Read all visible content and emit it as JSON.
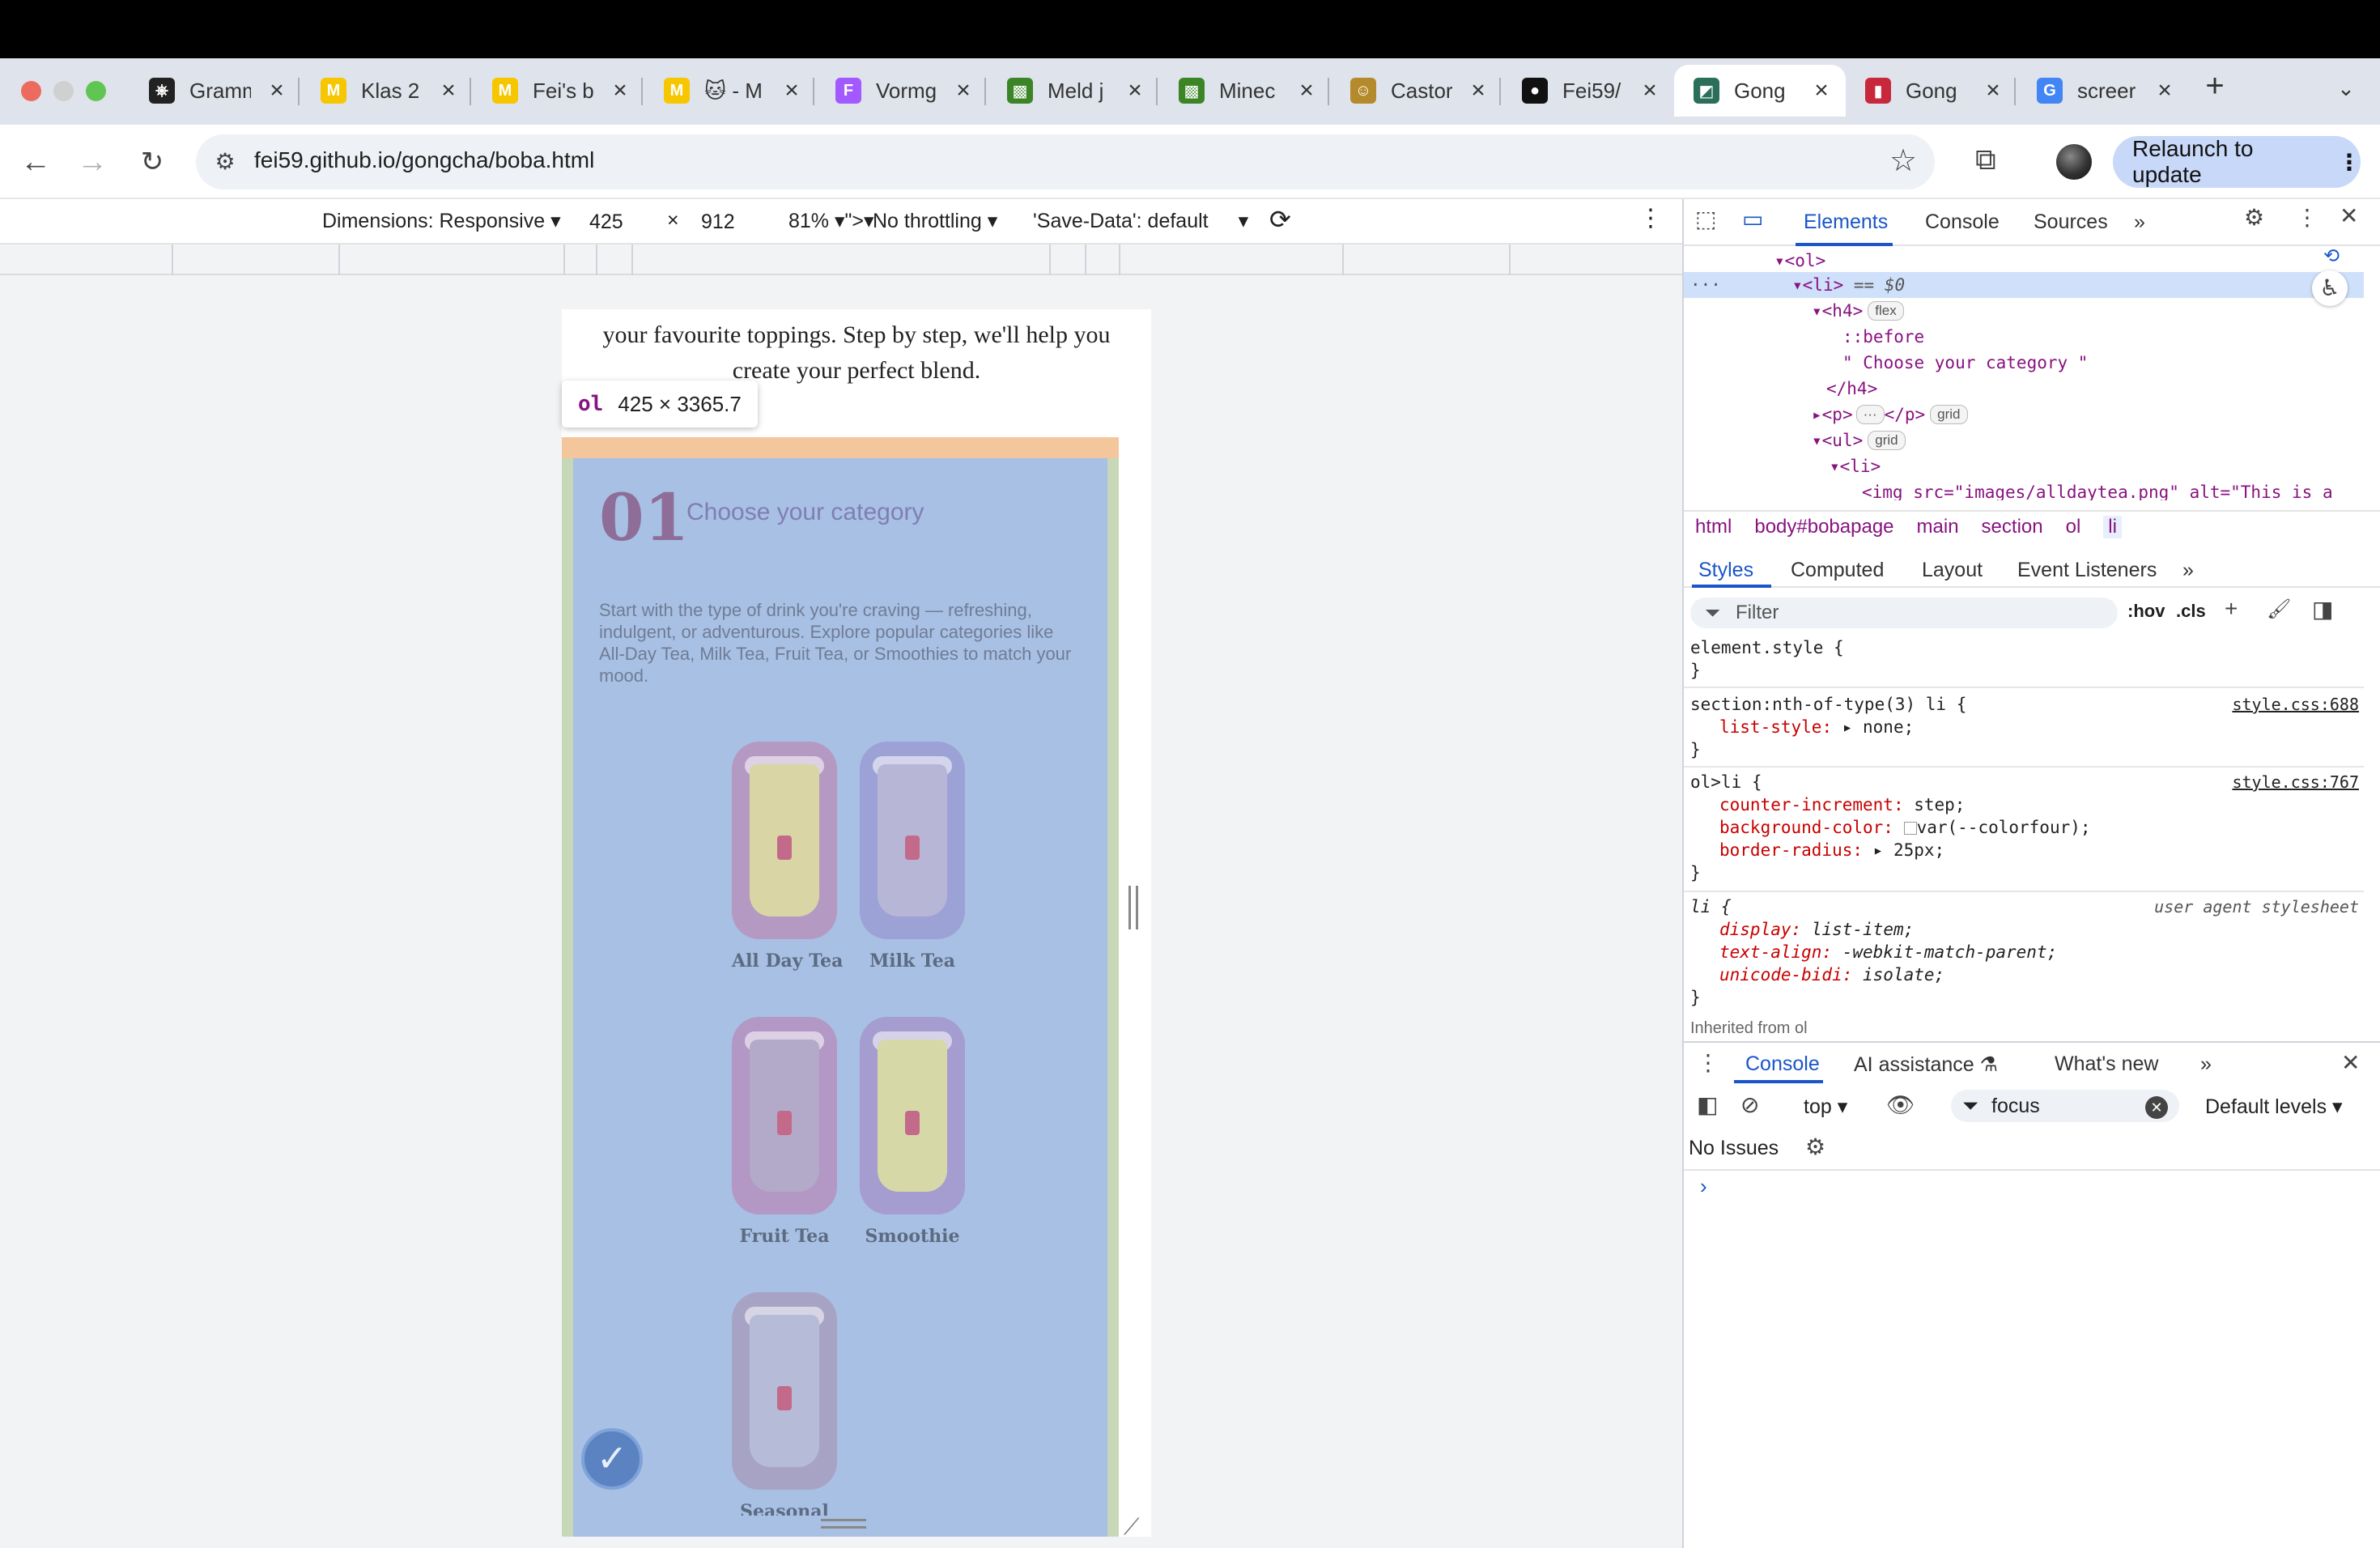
{
  "window": {
    "traffic_lights": [
      "#ed6a5e",
      "#d0d0d0",
      "#61c554"
    ]
  },
  "tabs": [
    {
      "title": "Gramm",
      "icon": "chatgpt-icon",
      "color": "#222222",
      "glyph": "⎈"
    },
    {
      "title": "Klas 2",
      "icon": "miro-icon",
      "color": "#f6c700",
      "glyph": "M"
    },
    {
      "title": "Fei's b",
      "icon": "miro-icon",
      "color": "#f6c700",
      "glyph": "M"
    },
    {
      "title": "🐱 - M",
      "icon": "miro-icon",
      "color": "#f6c700",
      "glyph": "M"
    },
    {
      "title": "Vormg",
      "icon": "figma-icon",
      "color": "#a259ff",
      "glyph": "F"
    },
    {
      "title": "Meld j",
      "icon": "minecraft-icon",
      "color": "#3c8527",
      "glyph": "▩"
    },
    {
      "title": "Minec",
      "icon": "minecraft-icon",
      "color": "#3c8527",
      "glyph": "▩"
    },
    {
      "title": "Castor",
      "icon": "castor-icon",
      "color": "#b58a2c",
      "glyph": "☺"
    },
    {
      "title": "Fei59/",
      "icon": "github-icon",
      "color": "#111111",
      "glyph": "●"
    },
    {
      "title": "Gong",
      "icon": "gongcha-icon",
      "color": "#2b6e5a",
      "glyph": "◩",
      "active": true
    },
    {
      "title": "Gong",
      "icon": "gongcha-red-icon",
      "color": "#c8283c",
      "glyph": "▮"
    },
    {
      "title": "screer",
      "icon": "google-icon",
      "color": "#4285f4",
      "glyph": "G"
    }
  ],
  "toolbar": {
    "url": "fei59.github.io/gongcha/boba.html",
    "relaunch_label": "Relaunch to update"
  },
  "device_toolbar": {
    "dimensions": "Dimensions: Responsive",
    "width": "425",
    "times": "×",
    "height": "912",
    "zoom": "81%",
    "throttling": "No throttling",
    "save_data": "'Save-Data': default"
  },
  "page": {
    "intro": "your favourite toppings. Step by step, we'll help you create your perfect blend.",
    "step_number": "01",
    "step_title": "Choose your category",
    "step_description": "Start with the type of drink you're craving — refreshing, indulgent, or adventurous. Explore popular categories like All-Day Tea, Milk Tea, Fruit Tea, or Smoothies to match your mood.",
    "categories": [
      {
        "label": "All Day Tea",
        "bg": "#b49ac2",
        "drink": "#d9d5a4"
      },
      {
        "label": "Milk Tea",
        "bg": "#9da2d6",
        "drink": "#b8b6d6"
      },
      {
        "label": "Fruit Tea",
        "bg": "#b397c4",
        "drink": "#b3a9c9"
      },
      {
        "label": "Smoothie",
        "bg": "#a59ccf",
        "drink": "#d7d8a8"
      },
      {
        "label": "Seasonal",
        "bg": "#a7a3c4",
        "drink": "#b6bcd8"
      }
    ],
    "tooltip_tag": "ol",
    "tooltip_size": "425 × 3365.7"
  },
  "devtools": {
    "tabs": [
      "Elements",
      "Console",
      "Sources"
    ],
    "tree": {
      "ol_open": "<ol>",
      "li_open": "<li>",
      "li_marker": "== $0",
      "h4_open": "<h4>",
      "before": "::before",
      "h4_text": "\" Choose your category \"",
      "h4_close": "</h4>",
      "p_line": "<p>",
      "p_close": "</p>",
      "ul_open": "<ul>",
      "li2_open": "<li>",
      "img_line": "<img src=\"images/alldaytea.png\" alt=\"This is a",
      "badge_flex": "flex",
      "badge_grid": "grid"
    },
    "breadcrumbs": [
      "html",
      "body#bobapage",
      "main",
      "section",
      "ol",
      "li"
    ],
    "styles_tabs": [
      "Styles",
      "Computed",
      "Layout",
      "Event Listeners"
    ],
    "filter_placeholder": "Filter",
    "hov": ":hov",
    "cls": ".cls",
    "rules": {
      "element_style": "element.style {",
      "close": "}",
      "r1_selector": "section:nth-of-type(3) li {",
      "r1_source": "style.css:688",
      "r1_p1": "list-style",
      "r1_v1": "▸ none;",
      "r2_selector": "ol>li {",
      "r2_source": "style.css:767",
      "r2_p1": "counter-increment",
      "r2_v1": "step;",
      "r2_p2": "background-color",
      "r2_v2": "var(--colorfour);",
      "r2_p3": "border-radius",
      "r2_v3": "▸ 25px;",
      "r3_selector": "li {",
      "r3_source": "user agent stylesheet",
      "r3_p1": "display",
      "r3_v1": "list-item;",
      "r3_p2": "text-align",
      "r3_v2": "-webkit-match-parent;",
      "r3_p3": "unicode-bidi",
      "r3_v3": "isolate;",
      "inherited": "Inherited from ol"
    },
    "drawer_tabs": [
      "Console",
      "AI assistance",
      "What's new"
    ],
    "context": "top",
    "console_filter": "focus",
    "levels": "Default levels",
    "no_issues": "No Issues",
    "prompt": "›"
  }
}
